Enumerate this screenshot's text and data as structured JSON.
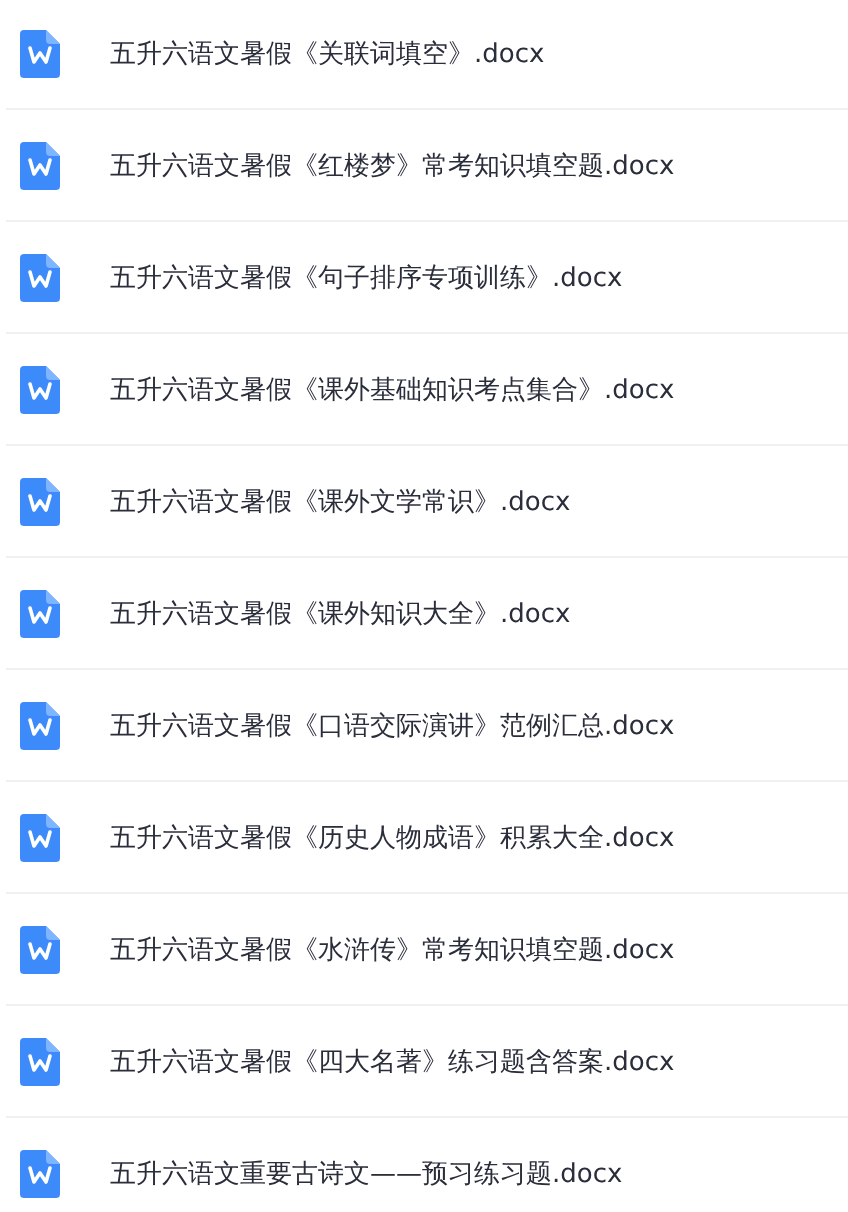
{
  "files": [
    {
      "name": "五升六语文暑假《关联词填空》.docx"
    },
    {
      "name": "五升六语文暑假《红楼梦》常考知识填空题.docx"
    },
    {
      "name": "五升六语文暑假《句子排序专项训练》.docx"
    },
    {
      "name": "五升六语文暑假《课外基础知识考点集合》.docx"
    },
    {
      "name": "五升六语文暑假《课外文学常识》.docx"
    },
    {
      "name": "五升六语文暑假《课外知识大全》.docx"
    },
    {
      "name": "五升六语文暑假《口语交际演讲》范例汇总.docx"
    },
    {
      "name": "五升六语文暑假《历史人物成语》积累大全.docx"
    },
    {
      "name": "五升六语文暑假《水浒传》常考知识填空题.docx"
    },
    {
      "name": "五升六语文暑假《四大名著》练习题含答案.docx"
    },
    {
      "name": "五升六语文重要古诗文——预习练习题.docx"
    }
  ]
}
